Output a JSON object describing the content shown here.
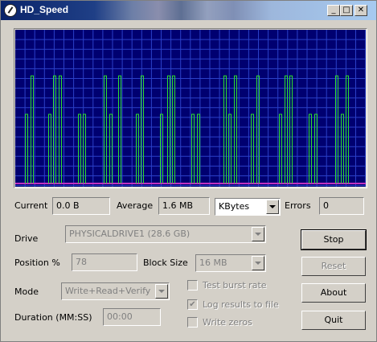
{
  "window": {
    "title": "HD_Speed",
    "minimize_glyph": "_",
    "maximize_glyph": "□",
    "close_glyph": "✕"
  },
  "graph": {
    "background": "#000070",
    "grid_color": "#2b40c8",
    "line_color": "#2ee02e",
    "baseline_color": "#c030c0",
    "spike_levels": {
      "low": 0.45,
      "high": 0.7
    },
    "spikes": [
      {
        "x": 0.035,
        "level": "low"
      },
      {
        "x": 0.05,
        "level": "high"
      },
      {
        "x": 0.1,
        "level": "low"
      },
      {
        "x": 0.115,
        "level": "high"
      },
      {
        "x": 0.13,
        "level": "high"
      },
      {
        "x": 0.185,
        "level": "low"
      },
      {
        "x": 0.2,
        "level": "low"
      },
      {
        "x": 0.26,
        "level": "high"
      },
      {
        "x": 0.275,
        "level": "low"
      },
      {
        "x": 0.3,
        "level": "high"
      },
      {
        "x": 0.35,
        "level": "low"
      },
      {
        "x": 0.365,
        "level": "high"
      },
      {
        "x": 0.42,
        "level": "low"
      },
      {
        "x": 0.44,
        "level": "high"
      },
      {
        "x": 0.455,
        "level": "high"
      },
      {
        "x": 0.51,
        "level": "low"
      },
      {
        "x": 0.525,
        "level": "low"
      },
      {
        "x": 0.6,
        "level": "high"
      },
      {
        "x": 0.615,
        "level": "low"
      },
      {
        "x": 0.63,
        "level": "high"
      },
      {
        "x": 0.68,
        "level": "low"
      },
      {
        "x": 0.695,
        "level": "high"
      },
      {
        "x": 0.76,
        "level": "low"
      },
      {
        "x": 0.775,
        "level": "high"
      },
      {
        "x": 0.79,
        "level": "high"
      },
      {
        "x": 0.845,
        "level": "low"
      },
      {
        "x": 0.86,
        "level": "low"
      },
      {
        "x": 0.92,
        "level": "high"
      },
      {
        "x": 0.935,
        "level": "low"
      },
      {
        "x": 0.95,
        "level": "high"
      }
    ]
  },
  "stats": {
    "current_label": "Current",
    "current_value": "0.0 B",
    "average_label": "Average",
    "average_value": "1.6 MB",
    "unit_selected": "KBytes",
    "errors_label": "Errors",
    "errors_value": "0"
  },
  "form": {
    "drive_label": "Drive",
    "drive_value": "PHYSICALDRIVE1 (28.6 GB)",
    "position_label": "Position %",
    "position_value": "78",
    "block_size_label": "Block Size",
    "block_size_value": "16 MB",
    "mode_label": "Mode",
    "mode_value": "Write+Read+Verify",
    "duration_label": "Duration (MM:SS)",
    "duration_value": "00:00",
    "test_burst_label": "Test burst rate",
    "test_burst_checked": false,
    "log_results_label": "Log results to file",
    "log_results_checked": true,
    "write_zeros_label": "Write zeros",
    "write_zeros_checked": false,
    "check_glyph": "✔"
  },
  "buttons": {
    "stop": "Stop",
    "reset": "Reset",
    "about": "About",
    "quit": "Quit"
  }
}
